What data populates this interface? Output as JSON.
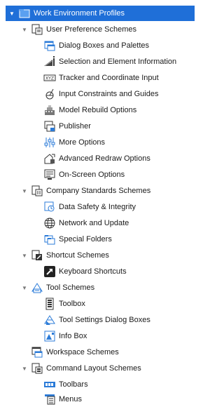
{
  "tree": {
    "root": {
      "label": "Work Environment Profiles",
      "icon": "folder-icon",
      "expanded": true,
      "selected": true
    },
    "user_pref": {
      "label": "User Preference Schemes",
      "icon": "scheme-icon",
      "expanded": true,
      "items": [
        {
          "label": "Dialog Boxes and Palettes",
          "icon": "dialog-boxes-icon"
        },
        {
          "label": "Selection and Element Information",
          "icon": "selection-info-icon"
        },
        {
          "label": "Tracker and Coordinate Input",
          "icon": "xyz-tracker-icon"
        },
        {
          "label": "Input Constraints and Guides",
          "icon": "constraints-icon"
        },
        {
          "label": "Model Rebuild Options",
          "icon": "model-rebuild-icon"
        },
        {
          "label": "Publisher",
          "icon": "publisher-icon"
        },
        {
          "label": "More Options",
          "icon": "more-options-icon"
        },
        {
          "label": "Advanced Redraw Options",
          "icon": "redraw-icon"
        },
        {
          "label": "On-Screen Options",
          "icon": "on-screen-icon"
        }
      ]
    },
    "company": {
      "label": "Company Standards Schemes",
      "icon": "scheme-icon",
      "expanded": true,
      "items": [
        {
          "label": "Data Safety & Integrity",
          "icon": "data-safety-icon"
        },
        {
          "label": "Network and Update",
          "icon": "globe-icon"
        },
        {
          "label": "Special Folders",
          "icon": "special-folders-icon"
        }
      ]
    },
    "shortcut": {
      "label": "Shortcut Schemes",
      "icon": "scheme-icon",
      "expanded": true,
      "items": [
        {
          "label": "Keyboard Shortcuts",
          "icon": "keyboard-shortcut-icon"
        }
      ]
    },
    "tool": {
      "label": "Tool Schemes",
      "icon": "tool-scheme-icon",
      "expanded": true,
      "items": [
        {
          "label": "Toolbox",
          "icon": "toolbox-icon"
        },
        {
          "label": "Tool Settings Dialog Boxes",
          "icon": "tool-settings-icon"
        },
        {
          "label": "Info Box",
          "icon": "info-box-icon"
        }
      ]
    },
    "workspace": {
      "label": "Workspace Schemes",
      "icon": "workspace-icon"
    },
    "command": {
      "label": "Command Layout Schemes",
      "icon": "scheme-icon",
      "expanded": true,
      "items": [
        {
          "label": "Toolbars",
          "icon": "toolbars-icon"
        },
        {
          "label": "Menus",
          "icon": "menus-icon"
        }
      ]
    }
  },
  "colors": {
    "selection": "#1f6fd8",
    "icon_blue": "#2b7bd8",
    "icon_dark": "#3a3a3a"
  }
}
